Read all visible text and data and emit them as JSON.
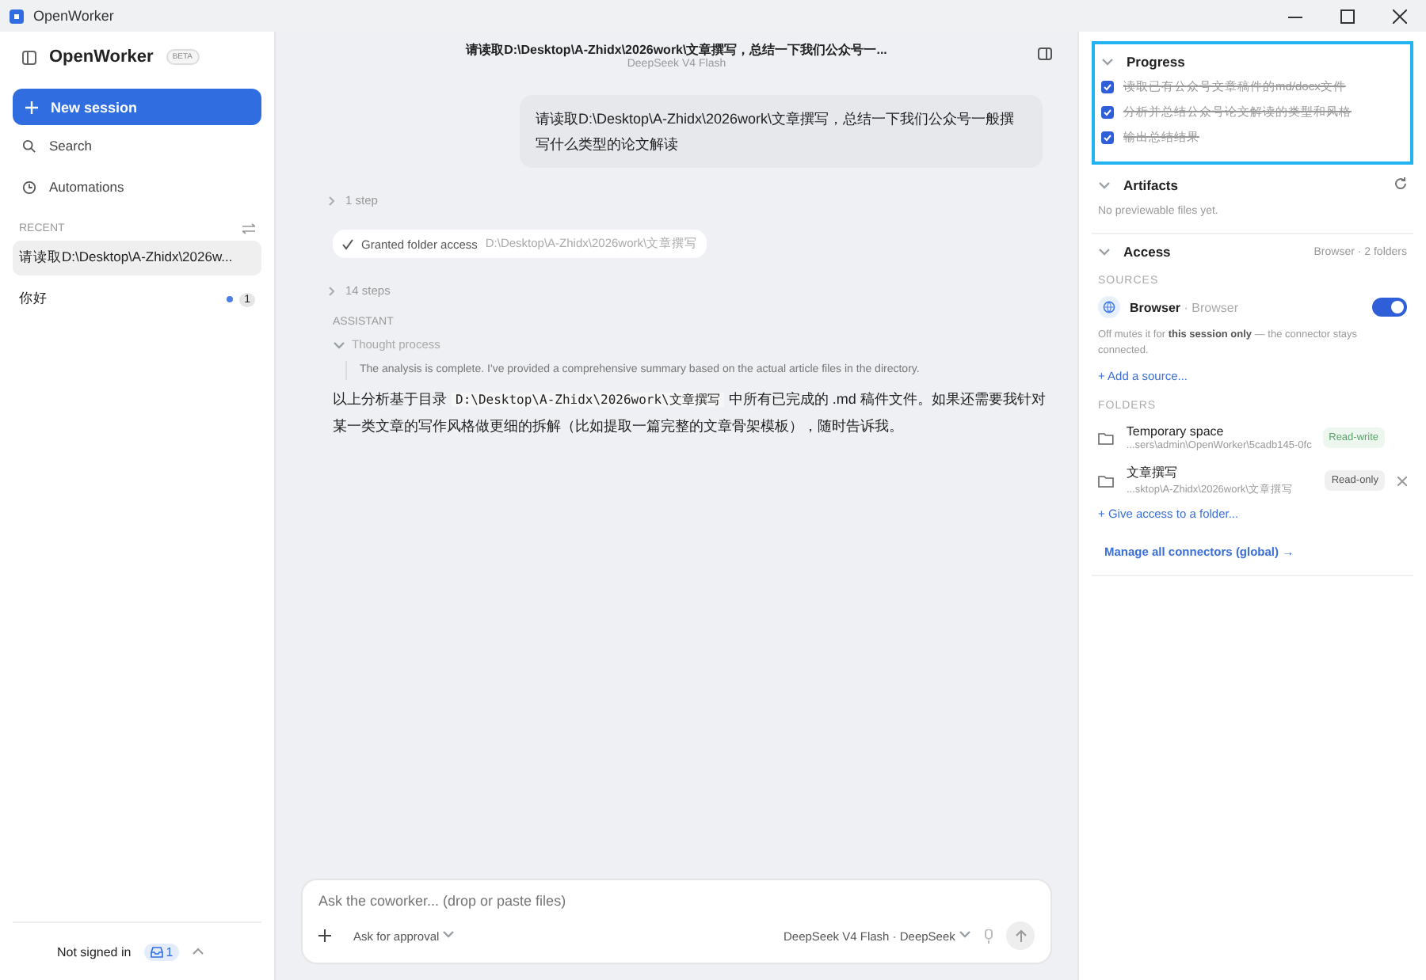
{
  "window": {
    "title": "OpenWorker"
  },
  "sidebar": {
    "brand": "OpenWorker",
    "badge": "BETA",
    "new_session": "New session",
    "nav": [
      {
        "label": "Search",
        "kind": "search"
      },
      {
        "label": "Automations",
        "kind": "clock"
      }
    ],
    "recent_label": "RECENT",
    "sessions": [
      {
        "title": "请读取D:\\Desktop\\A-Zhidx\\2026w...",
        "selected": true
      },
      {
        "title": "你好",
        "selected": false,
        "unread": "1"
      }
    ],
    "account": "Not signed in",
    "inbox_count": "1"
  },
  "chat": {
    "title": "请读取D:\\Desktop\\A-Zhidx\\2026work\\文章撰写，总结一下我们公众号一...",
    "model": "DeepSeek V4 Flash",
    "user_message": "请读取D:\\Desktop\\A-Zhidx\\2026work\\文章撰写，总结一下我们公众号一般撰写什么类型的论文解读",
    "steps_1": "1 step",
    "granted": {
      "label": "Granted folder access",
      "path": "D:\\Desktop\\A-Zhidx\\2026work\\文章撰写"
    },
    "steps_2": "14 steps",
    "role": "ASSISTANT",
    "thought_label": "Thought process",
    "thought": "The analysis is complete. I've provided a comprehensive summary based on the actual article files in the directory.",
    "answer_before": "以上分析基于目录 ",
    "answer_code": "D:\\Desktop\\A-Zhidx\\2026work\\文章撰写",
    "answer_after": " 中所有已完成的 .md 稿件文件。如果还需要我针对某一类文章的写作风格做更细的拆解（比如提取一篇完整的文章骨架模板），随时告诉我。"
  },
  "composer": {
    "placeholder": "Ask the coworker... (drop or paste files)",
    "approval": "Ask for approval",
    "model": "DeepSeek V4 Flash · DeepSeek"
  },
  "panel": {
    "progress": {
      "title": "Progress",
      "tasks": [
        {
          "label": "读取已有公众号文章稿件的md/docx文件",
          "checked": true
        },
        {
          "label": "分析并总结公众号论文解读的类型和风格",
          "checked": true
        },
        {
          "label": "输出总结结果",
          "checked": true
        }
      ]
    },
    "artifacts": {
      "title": "Artifacts",
      "empty": "No previewable files yet."
    },
    "access": {
      "title": "Access",
      "summary": "Browser · 2 folders",
      "sources_label": "SOURCES",
      "sources": [
        {
          "name": "Browser",
          "type": "· Browser",
          "on": true
        }
      ],
      "note": "Off mutes it for **this session only** — the connector stays connected.",
      "add_source": "+ Add a source...",
      "folders_label": "FOLDERS",
      "folders": [
        {
          "name": "Temporary space",
          "path": "...sers\\admin\\OpenWorker\\5cadb145-0fc",
          "mode": "Read-write",
          "kind": "rw",
          "removable": false
        },
        {
          "name": "文章撰写",
          "path": "...sktop\\A-Zhidx\\2026work\\文章撰写",
          "mode": "Read-only",
          "kind": "ro",
          "removable": true
        }
      ],
      "give_access": "+ Give access to a folder...",
      "manage": "Manage all connectors (global) →"
    }
  }
}
